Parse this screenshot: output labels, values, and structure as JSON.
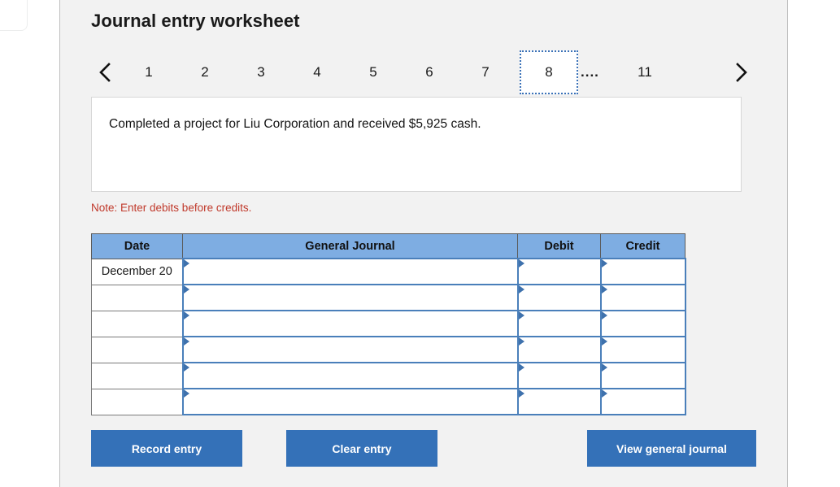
{
  "page_title": "Journal entry worksheet",
  "pager": {
    "prev_icon": "chevron-left-icon",
    "next_icon": "chevron-right-icon",
    "pages": [
      "1",
      "2",
      "3",
      "4",
      "5",
      "6",
      "7",
      "8"
    ],
    "active_page": "8",
    "ellipsis": "....",
    "last_page": "11"
  },
  "prompt": {
    "text": "Completed a project for Liu Corporation and received $5,925 cash."
  },
  "note": "Note: Enter debits before credits.",
  "table": {
    "headers": [
      "Date",
      "General Journal",
      "Debit",
      "Credit"
    ],
    "rows": [
      {
        "date": "December 20",
        "general_journal": "",
        "debit": "",
        "credit": ""
      },
      {
        "date": "",
        "general_journal": "",
        "debit": "",
        "credit": ""
      },
      {
        "date": "",
        "general_journal": "",
        "debit": "",
        "credit": ""
      },
      {
        "date": "",
        "general_journal": "",
        "debit": "",
        "credit": ""
      },
      {
        "date": "",
        "general_journal": "",
        "debit": "",
        "credit": ""
      },
      {
        "date": "",
        "general_journal": "",
        "debit": "",
        "credit": ""
      }
    ]
  },
  "buttons": {
    "record": "Record entry",
    "clear": "Clear entry",
    "view": "View general journal"
  },
  "colors": {
    "accent_blue": "#3471b8",
    "header_blue": "#7eade2",
    "note_red": "#c0392b",
    "panel_bg": "#f2f2f2",
    "cell_border_blue": "#4a7fba"
  }
}
